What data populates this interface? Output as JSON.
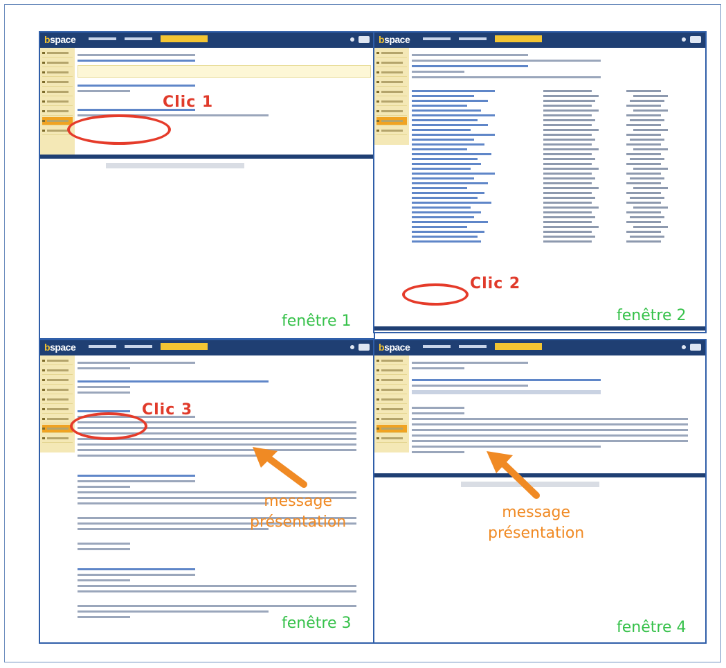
{
  "app": {
    "logo_prefix": "b",
    "logo_text": "space"
  },
  "annotations": {
    "clic1": "Clic 1",
    "clic2": "Clic 2",
    "clic3": "Clic 3",
    "window1": "fenêtre 1",
    "window2": "fenêtre 2",
    "window3": "fenêtre 3",
    "window4": "fenêtre 4",
    "message_line1": "message",
    "message_line2": "présentation"
  },
  "colors": {
    "annotation_red": "#e53b2a",
    "annotation_green": "#36c14a",
    "annotation_orange": "#f08a24",
    "topbar": "#1f3f73",
    "sidebar": "#f4e8b6",
    "active_tab": "#f3c533"
  },
  "icons": [
    "arrow-icon"
  ]
}
